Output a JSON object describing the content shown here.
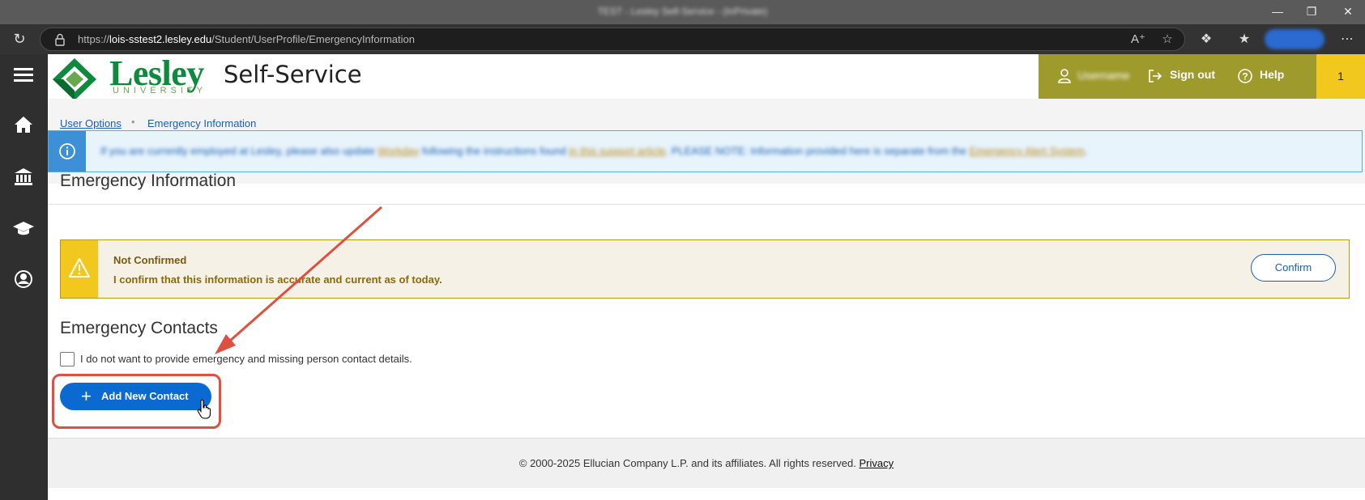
{
  "browser": {
    "tab_title": "TEST - Lesley Self-Service - (InPrivate)",
    "url_prefix": "https://",
    "url_host": "lois-sstest2.lesley.edu",
    "url_path": "/Student/UserProfile/EmergencyInformation",
    "profile_label": "InPrivate"
  },
  "header": {
    "logo_name": "Lesley",
    "logo_sub": "UNIVERSITY",
    "app_title": "Self-Service",
    "username": "Username",
    "sign_out": "Sign out",
    "help": "Help",
    "notification_count": "1",
    "band_color": "#9e9a2c",
    "accent_color": "#f2c81f"
  },
  "breadcrumb": {
    "parent": "User Options",
    "current": "Emergency Information"
  },
  "info_banner": {
    "text_before": "If you are currently employed at Lesley, please also update ",
    "link1": "Workday",
    "text_mid1": " following the instructions found ",
    "link2": "in this support article",
    "text_mid2": ". PLEASE NOTE: Information provided here is separate from the ",
    "link3": "Emergency Alert System",
    "text_after": "."
  },
  "page_title": "Emergency Information",
  "confirmation": {
    "status": "Not Confirmed",
    "message": "I confirm that this information is accurate and current as of today.",
    "button": "Confirm"
  },
  "contacts": {
    "title": "Emergency Contacts",
    "opt_out_label": "I do not want to provide emergency and missing person contact details.",
    "add_button": "Add New Contact"
  },
  "footer": {
    "copyright": "© 2000-2025 Ellucian Company L.P. and its affiliates. All rights reserved.",
    "privacy": "Privacy"
  }
}
